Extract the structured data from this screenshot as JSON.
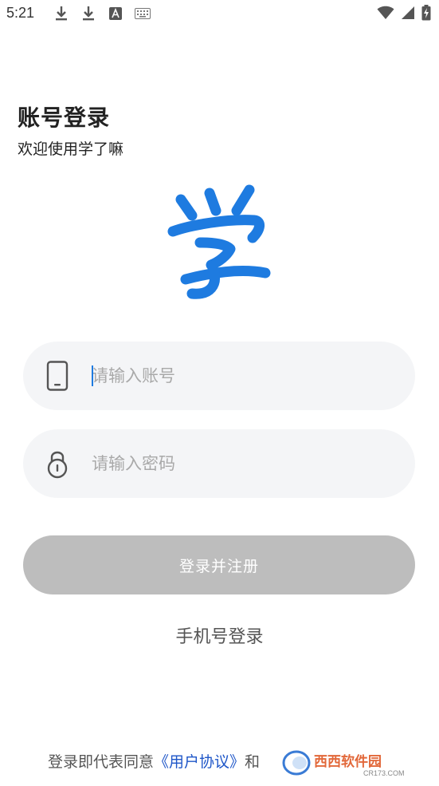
{
  "status_bar": {
    "time": "5:21",
    "left_icons": [
      "download-icon",
      "download-icon",
      "a-badge-icon",
      "keyboard-icon"
    ],
    "right_icons": [
      "wifi-icon",
      "signal-icon",
      "battery-charging-icon"
    ]
  },
  "header": {
    "title": "账号登录",
    "subtitle": "欢迎使用学了嘛"
  },
  "logo": {
    "glyph": "学",
    "color": "#1e7be0"
  },
  "form": {
    "account": {
      "placeholder": "请输入账号",
      "value": "",
      "icon": "phone-icon"
    },
    "password": {
      "placeholder": "请输入密码",
      "value": "",
      "icon": "lock-icon"
    },
    "submit_label": "登录并注册",
    "submit_color": "#bdbdbd"
  },
  "alt_login": {
    "label": "手机号登录"
  },
  "agreement": {
    "prefix": "登录即代表同意",
    "user_agreement": "《用户协议》",
    "joiner": "和"
  },
  "watermark": {
    "brand": "西西软件园",
    "site": "CR173.COM"
  }
}
